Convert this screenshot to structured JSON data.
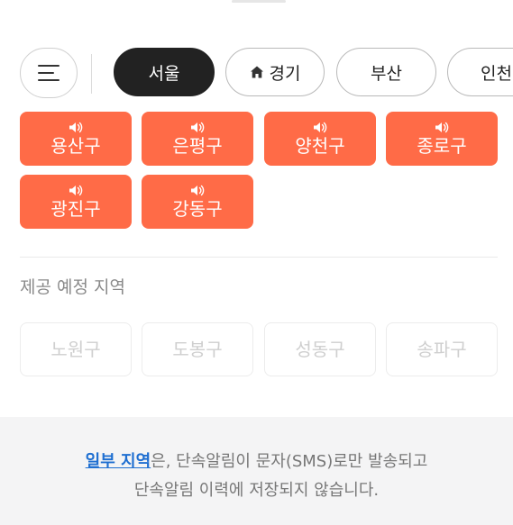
{
  "regions": [
    {
      "label": "서울",
      "active": true
    },
    {
      "label": "경기",
      "active": false,
      "icon": "home-icon"
    },
    {
      "label": "부산",
      "active": false
    },
    {
      "label": "인천",
      "active": false
    }
  ],
  "active_districts": [
    {
      "label": "용산구",
      "icon": "speaker-icon"
    },
    {
      "label": "은평구",
      "icon": "speaker-icon"
    },
    {
      "label": "양천구",
      "icon": "speaker-icon"
    },
    {
      "label": "종로구",
      "icon": "speaker-icon"
    },
    {
      "label": "광진구",
      "icon": "speaker-icon"
    },
    {
      "label": "강동구",
      "icon": "speaker-icon"
    }
  ],
  "planned_section": {
    "title": "제공 예정 지역",
    "districts": [
      "노원구",
      "도봉구",
      "성동구",
      "송파구"
    ]
  },
  "footer": {
    "link": "일부 지역",
    "line1_rest": "은, 단속알림이 문자(SMS)로만 발송되고",
    "line2": "단속알림 이력에 저장되지 않습니다."
  },
  "colors": {
    "accent": "#ff6b47",
    "active_chip": "#222222",
    "link": "#1f6fd1",
    "footer_bg": "#f4f4f5"
  }
}
